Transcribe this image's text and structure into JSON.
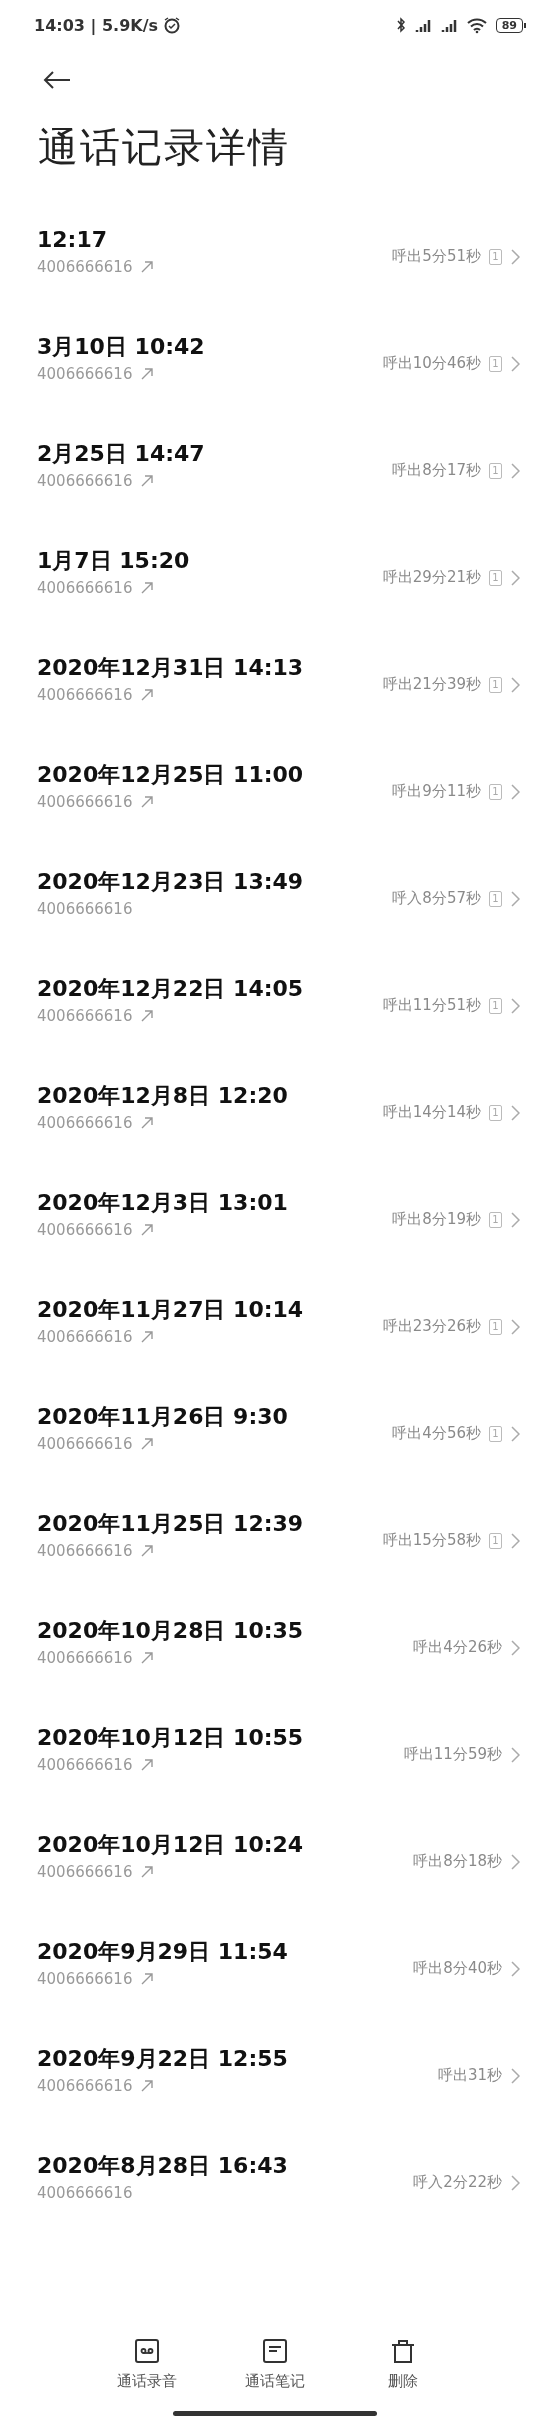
{
  "status_bar": {
    "time_speed": "14:03 | 5.9K/s",
    "battery": "89"
  },
  "title": "通话记录详情",
  "calls": [
    {
      "datetime": "12:17",
      "number": "4006666616",
      "kind": "outgoing",
      "summary": "呼出5分51秒",
      "sim": "1"
    },
    {
      "datetime": "3月10日 10:42",
      "number": "4006666616",
      "kind": "outgoing",
      "summary": "呼出10分46秒",
      "sim": "1"
    },
    {
      "datetime": "2月25日 14:47",
      "number": "4006666616",
      "kind": "outgoing",
      "summary": "呼出8分17秒",
      "sim": "1"
    },
    {
      "datetime": "1月7日 15:20",
      "number": "4006666616",
      "kind": "outgoing",
      "summary": "呼出29分21秒",
      "sim": "1"
    },
    {
      "datetime": "2020年12月31日 14:13",
      "number": "4006666616",
      "kind": "outgoing",
      "summary": "呼出21分39秒",
      "sim": "1"
    },
    {
      "datetime": "2020年12月25日 11:00",
      "number": "4006666616",
      "kind": "outgoing",
      "summary": "呼出9分11秒",
      "sim": "1"
    },
    {
      "datetime": "2020年12月23日 13:49",
      "number": "4006666616",
      "kind": "incoming",
      "summary": "呼入8分57秒",
      "sim": "1"
    },
    {
      "datetime": "2020年12月22日 14:05",
      "number": "4006666616",
      "kind": "outgoing",
      "summary": "呼出11分51秒",
      "sim": "1"
    },
    {
      "datetime": "2020年12月8日 12:20",
      "number": "4006666616",
      "kind": "outgoing",
      "summary": "呼出14分14秒",
      "sim": "1"
    },
    {
      "datetime": "2020年12月3日 13:01",
      "number": "4006666616",
      "kind": "outgoing",
      "summary": "呼出8分19秒",
      "sim": "1"
    },
    {
      "datetime": "2020年11月27日 10:14",
      "number": "4006666616",
      "kind": "outgoing",
      "summary": "呼出23分26秒",
      "sim": "1"
    },
    {
      "datetime": "2020年11月26日 9:30",
      "number": "4006666616",
      "kind": "outgoing",
      "summary": "呼出4分56秒",
      "sim": "1"
    },
    {
      "datetime": "2020年11月25日 12:39",
      "number": "4006666616",
      "kind": "outgoing",
      "summary": "呼出15分58秒",
      "sim": "1"
    },
    {
      "datetime": "2020年10月28日 10:35",
      "number": "4006666616",
      "kind": "outgoing",
      "summary": "呼出4分26秒"
    },
    {
      "datetime": "2020年10月12日 10:55",
      "number": "4006666616",
      "kind": "outgoing",
      "summary": "呼出11分59秒"
    },
    {
      "datetime": "2020年10月12日 10:24",
      "number": "4006666616",
      "kind": "outgoing",
      "summary": "呼出8分18秒"
    },
    {
      "datetime": "2020年9月29日 11:54",
      "number": "4006666616",
      "kind": "outgoing",
      "summary": "呼出8分40秒"
    },
    {
      "datetime": "2020年9月22日 12:55",
      "number": "4006666616",
      "kind": "outgoing",
      "summary": "呼出31秒"
    },
    {
      "datetime": "2020年8月28日 16:43",
      "number": "4006666616",
      "kind": "incoming",
      "summary": "呼入2分22秒"
    }
  ],
  "toolbar": [
    {
      "kind": "recording",
      "label": "通话录音"
    },
    {
      "kind": "notes",
      "label": "通话笔记"
    },
    {
      "kind": "delete",
      "label": "删除"
    }
  ]
}
